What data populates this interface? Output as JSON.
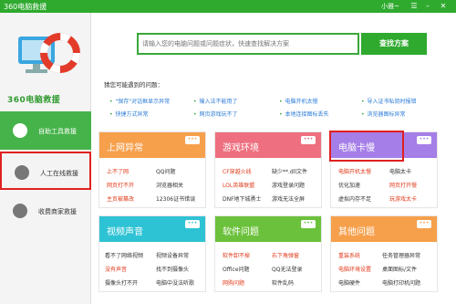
{
  "window": {
    "title": "360电脑救援",
    "user": "小雅~"
  },
  "sidebar": {
    "brand": "360电脑救援",
    "items": [
      {
        "label": "自助工具救援",
        "active": true
      },
      {
        "label": "人工在线救援",
        "active": false
      },
      {
        "label": "收费商家救援",
        "active": false
      }
    ]
  },
  "search": {
    "placeholder": "请输入您的电脑问题或问题症状，快速查找解决方案",
    "button": "查找方案"
  },
  "hint": "猜您可能遇到的问题：",
  "tips": [
    "\"保存\"对话框显示异常",
    "输入法不能用了",
    "电脑开机太慢",
    "导入证书私钥时报错",
    "快捷方式异常",
    "网页游戏玩不了",
    "本地连接图标丢失",
    "浏览器图标异常"
  ],
  "cards": [
    {
      "title": "上网异常",
      "items": [
        "上不了网",
        "QQ问题",
        "网页打不开",
        "浏览器相关",
        "主页被篡改",
        "12306证书错误"
      ],
      "hot": [
        0,
        2,
        4
      ]
    },
    {
      "title": "游戏环境",
      "items": [
        "CF穿越火线",
        "缺少**.dll文件",
        "LOL英雄联盟",
        "游戏登录问题",
        "DNF地下城勇士",
        "游戏无法全屏"
      ],
      "hot": [
        0,
        2
      ]
    },
    {
      "title": "电脑卡慢",
      "items": [
        "电脑开机太慢",
        "电脑太卡",
        "优化加速",
        "网页打开慢",
        "虚拟内存不足",
        "玩游戏太卡"
      ],
      "hot": [
        0,
        3,
        5
      ]
    },
    {
      "title": "视频声音",
      "items": [
        "看不了网络视频",
        "视频设备异常",
        "没有声音",
        "找不到摄像头",
        "摄像头打不开",
        "电脑中没法听歌"
      ],
      "hot": [
        2
      ]
    },
    {
      "title": "软件问题",
      "items": [
        "软件卸不掉",
        "右下角弹窗",
        "Office问题",
        "QQ无法登录",
        "网购问题",
        "软件乱码"
      ],
      "hot": [
        0,
        1,
        4
      ]
    },
    {
      "title": "其他问题",
      "items": [
        "重装系统",
        "任务管理器异常",
        "电脑环境设置",
        "桌面图标/文件",
        "电脑硬件",
        "电脑打印机问题"
      ],
      "hot": [
        0,
        2
      ]
    }
  ],
  "more_label": "•••"
}
